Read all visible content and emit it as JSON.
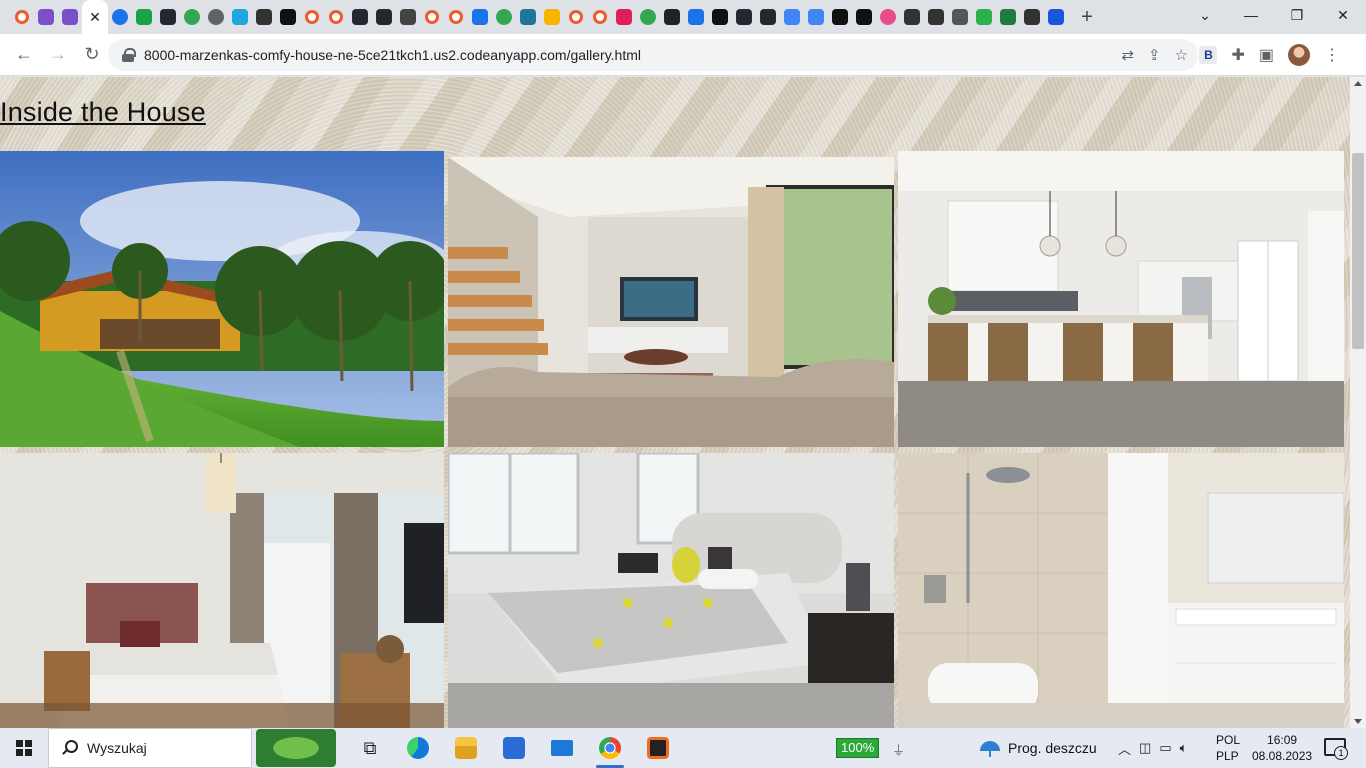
{
  "browser": {
    "tabs": [
      {
        "icon": "orange-ring-icon",
        "color": "#f05a28"
      },
      {
        "icon": "purple-cube-icon",
        "color": "#7b4fc9"
      },
      {
        "icon": "purple-cube-icon",
        "color": "#7b4fc9"
      },
      {
        "icon": "close-icon",
        "active": true
      },
      {
        "icon": "blue-globe-icon",
        "color": "#1a73e8"
      },
      {
        "icon": "green-d-icon",
        "color": "#17a34a"
      },
      {
        "icon": "github-icon",
        "color": "#24292f"
      },
      {
        "icon": "globe-icon",
        "color": "#34a853"
      },
      {
        "icon": "globe-icon",
        "color": "#5f6368"
      },
      {
        "icon": "c-icon",
        "color": "#1ea7e1"
      },
      {
        "icon": "dots-icon",
        "color": "#333333"
      },
      {
        "icon": "u-icon",
        "color": "#111111"
      },
      {
        "icon": "orange-ring-icon",
        "color": "#f05a28"
      },
      {
        "icon": "orange-ring-icon",
        "color": "#f05a28"
      },
      {
        "icon": "github-icon",
        "color": "#24292f"
      },
      {
        "icon": "github-icon",
        "color": "#24292f"
      },
      {
        "icon": "markdown-icon",
        "color": "#444444"
      },
      {
        "icon": "orange-ring-icon",
        "color": "#f05a28"
      },
      {
        "icon": "orange-ring-icon",
        "color": "#f05a28"
      },
      {
        "icon": "flag-icon",
        "color": "#1a73e8"
      },
      {
        "icon": "globe-icon",
        "color": "#34a853"
      },
      {
        "icon": "wordpress-icon",
        "color": "#21759b"
      },
      {
        "icon": "h-icon",
        "color": "#f7b500"
      },
      {
        "icon": "orange-ring-icon",
        "color": "#f05a28"
      },
      {
        "icon": "orange-ring-icon",
        "color": "#f05a28"
      },
      {
        "icon": "slack-icon",
        "color": "#e01e5a"
      },
      {
        "icon": "chrome-icon",
        "color": "#34a853"
      },
      {
        "icon": "sej-icon",
        "color": "#222222"
      },
      {
        "icon": "link-icon",
        "color": "#1a73e8"
      },
      {
        "icon": "triangle-icon",
        "color": "#111111"
      },
      {
        "icon": "github-icon",
        "color": "#24292f"
      },
      {
        "icon": "github-icon",
        "color": "#24292f"
      },
      {
        "icon": "colorful-icon",
        "color": "#4285f4"
      },
      {
        "icon": "translate-icon",
        "color": "#4285f4"
      },
      {
        "icon": "m-icon",
        "color": "#111111"
      },
      {
        "icon": "w-icon",
        "color": "#111111"
      },
      {
        "icon": "dribbble-icon",
        "color": "#ea4c89"
      },
      {
        "icon": "wreath-icon",
        "color": "#333333"
      },
      {
        "icon": "brackets-icon",
        "color": "#333333"
      },
      {
        "icon": "hd-icon",
        "color": "#555555"
      },
      {
        "icon": "px-icon",
        "color": "#2bb24c"
      },
      {
        "icon": "w3-icon",
        "color": "#1f7a3d"
      },
      {
        "icon": "circle-icon",
        "color": "#333333"
      },
      {
        "icon": "xc-icon",
        "color": "#1a56db"
      }
    ],
    "url": "8000-marzenkas-comfy-house-ne-5ce21tkch1.us2.codeanyapp.com/gallery.html",
    "ext_label": "B"
  },
  "page": {
    "heading": "Inside the House",
    "photos": [
      {
        "name": "garden-house-photo",
        "scene": "exterior"
      },
      {
        "name": "living-room-photo",
        "scene": "living"
      },
      {
        "name": "kitchen-photo",
        "scene": "kitchen"
      },
      {
        "name": "bedroom-photo",
        "scene": "bedroom1"
      },
      {
        "name": "master-bedroom-photo",
        "scene": "bedroom2"
      },
      {
        "name": "bathroom-photo",
        "scene": "bathroom"
      }
    ]
  },
  "taskbar": {
    "search_placeholder": "Wyszukaj",
    "battery": "100%",
    "weather": "Prog. deszczu",
    "lang_top": "POL",
    "lang_bottom": "PLP",
    "time": "16:09",
    "date": "08.08.2023",
    "notifications": "1"
  },
  "colors": {
    "taskbar_bg": "#e5eaf2",
    "battery_green": "#2aa83a",
    "tab_strip": "#dee1e6"
  }
}
